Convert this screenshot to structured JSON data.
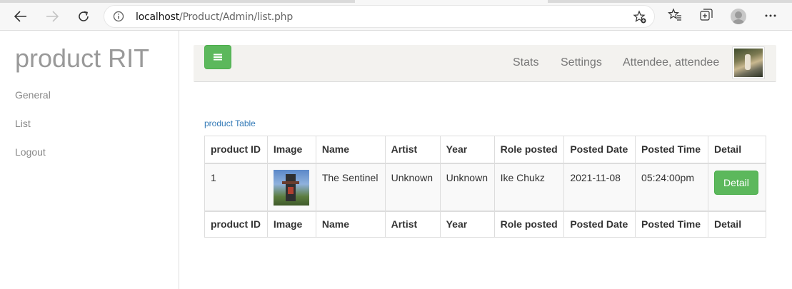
{
  "browser": {
    "url_host": "localhost",
    "url_path": "/Product/Admin/list.php"
  },
  "sidebar": {
    "brand": "product RIT",
    "items": [
      {
        "label": "General"
      },
      {
        "label": "List"
      },
      {
        "label": "Logout"
      }
    ]
  },
  "navbar": {
    "links": [
      {
        "label": "Stats"
      },
      {
        "label": "Settings"
      },
      {
        "label": "Attendee, attendee"
      }
    ]
  },
  "table": {
    "caption": "product Table",
    "columns": [
      "product ID",
      "Image",
      "Name",
      "Artist",
      "Year",
      "Role posted",
      "Posted Date",
      "Posted Time",
      "Detail"
    ],
    "rows": [
      {
        "product_id": "1",
        "name": "The Sentinel",
        "artist": "Unknown",
        "year": "Unknown",
        "role_posted": "Ike Chukz",
        "posted_date": "2021-11-08",
        "posted_time": "05:24:00pm",
        "detail_label": "Detail"
      }
    ]
  },
  "colors": {
    "accent_green": "#5cb85c",
    "link_blue": "#337ab7"
  }
}
